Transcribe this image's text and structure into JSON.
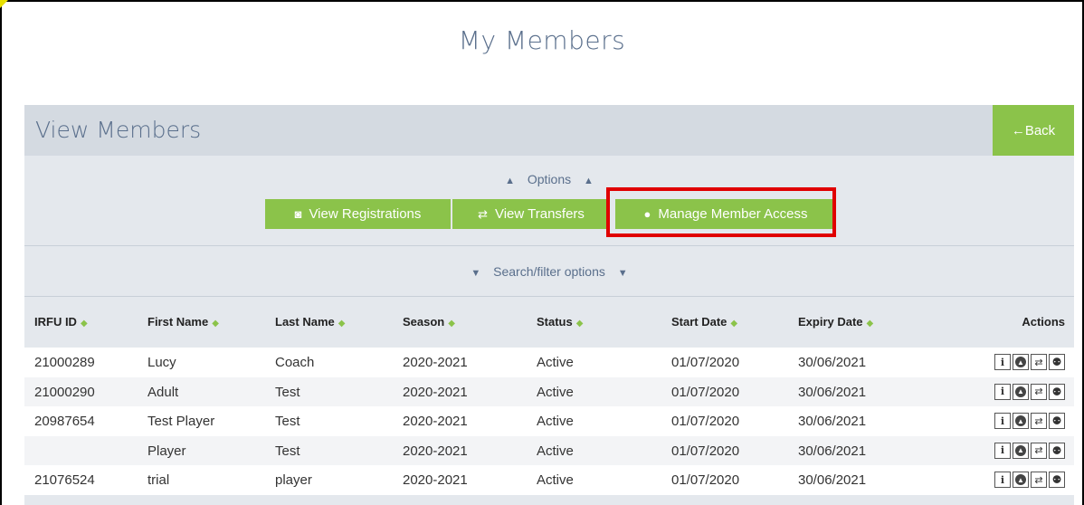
{
  "page": {
    "title": "My Members"
  },
  "panel": {
    "title": "View Members",
    "back_label": "←Back"
  },
  "options": {
    "toggle_label": "Options",
    "buttons": [
      {
        "label": "View Registrations",
        "icon": "money-icon"
      },
      {
        "label": "View Transfers",
        "icon": "transfer-icon"
      },
      {
        "label": "Manage Member Access",
        "icon": "user-icon"
      }
    ]
  },
  "search": {
    "toggle_label": "Search/filter options"
  },
  "table": {
    "columns": [
      "IRFU ID",
      "First Name",
      "Last Name",
      "Season",
      "Status",
      "Start Date",
      "Expiry Date",
      "Actions"
    ],
    "rows": [
      {
        "irfu_id": "21000289",
        "first_name": "Lucy",
        "last_name": "Coach",
        "season": "2020-2021",
        "status": "Active",
        "start_date": "01/07/2020",
        "expiry_date": "30/06/2021"
      },
      {
        "irfu_id": "21000290",
        "first_name": "Adult",
        "last_name": "Test",
        "season": "2020-2021",
        "status": "Active",
        "start_date": "01/07/2020",
        "expiry_date": "30/06/2021"
      },
      {
        "irfu_id": "20987654",
        "first_name": "Test Player",
        "last_name": "Test",
        "season": "2020-2021",
        "status": "Active",
        "start_date": "01/07/2020",
        "expiry_date": "30/06/2021"
      },
      {
        "irfu_id": "",
        "first_name": "Player",
        "last_name": "Test",
        "season": "2020-2021",
        "status": "Active",
        "start_date": "01/07/2020",
        "expiry_date": "30/06/2021"
      },
      {
        "irfu_id": "21076524",
        "first_name": "trial",
        "last_name": "player",
        "season": "2020-2021",
        "status": "Active",
        "start_date": "01/07/2020",
        "expiry_date": "30/06/2021"
      }
    ]
  },
  "colors": {
    "accent_green": "#8bc34a",
    "title_blue": "#5a6f8c",
    "highlight_red": "#e00000",
    "panel_bg": "#e4e8ed"
  }
}
